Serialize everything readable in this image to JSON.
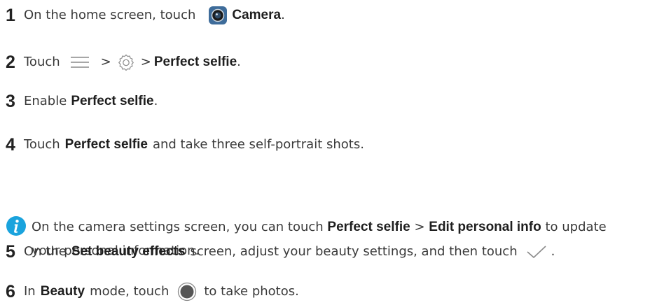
{
  "colors": {
    "text": "#3a3a3a",
    "bold_text": "#1e1e1e",
    "info_icon": "#1aa3dd",
    "camera_icon_bg": "#3e6c9a",
    "icon_stroke": "#8a8a8a"
  },
  "steps": [
    {
      "number": "1",
      "text_before": "On the home screen, touch",
      "bold": "Camera",
      "text_after": ".",
      "icon": "camera-app-icon"
    },
    {
      "number": "2",
      "text_before": "Touch",
      "sep1": ">",
      "sep2": ">",
      "bold": "Perfect selfie",
      "text_after": ".",
      "icons": [
        "menu-icon",
        "settings-gear-icon"
      ]
    },
    {
      "number": "3",
      "text_before": "Enable",
      "bold": "Perfect selfie",
      "text_after": "."
    },
    {
      "number": "4",
      "text_before": "Touch",
      "bold": "Perfect selfie",
      "text_after": "and take three self-portrait shots."
    },
    {
      "number": "5",
      "text_before": "On the",
      "bold": "Set beauty effects",
      "text_after": "screen, adjust your beauty settings, and then touch",
      "text_end": ".",
      "icon": "checkmark-icon"
    },
    {
      "number": "6",
      "text_before": "In",
      "bold": "Beauty",
      "text_after": "mode, touch",
      "text_end": "to take photos.",
      "icon": "shutter-icon"
    }
  ],
  "note": {
    "icon": "info-icon",
    "text_before": "On the camera settings screen, you can touch",
    "bold1": "Perfect selfie",
    "sep": ">",
    "bold2": "Edit personal info",
    "text_after": "to update your personal information."
  }
}
